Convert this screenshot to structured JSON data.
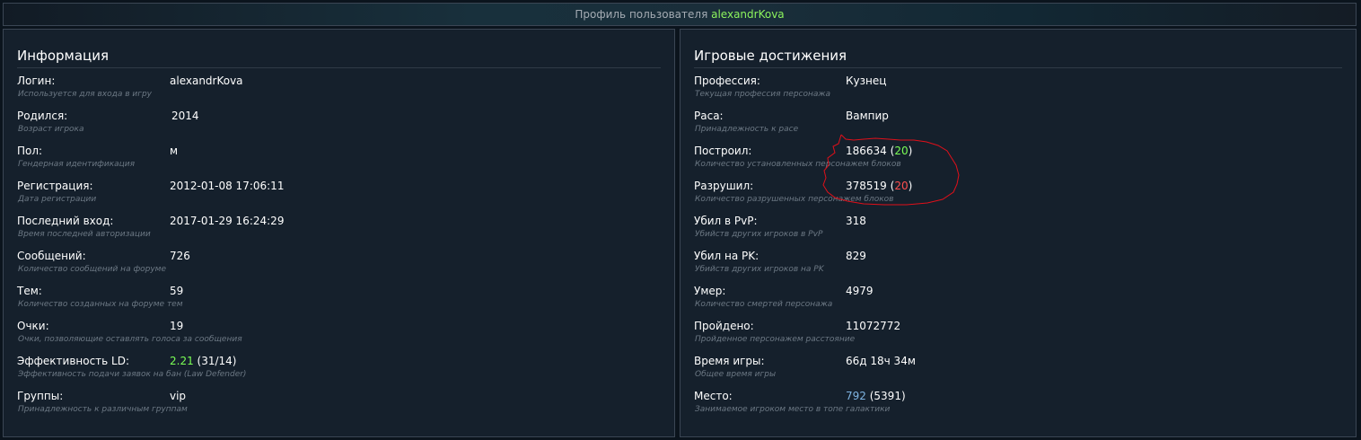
{
  "header": {
    "prefix": "Профиль пользователя",
    "username": "alexandrKova"
  },
  "info": {
    "title": "Информация",
    "rows": [
      {
        "label": "Логин:",
        "value": "alexandrKova",
        "desc": "Используется для входа в игру"
      },
      {
        "label": "Родился:",
        "value": "2014",
        "desc": "Возраст игрока"
      },
      {
        "label": "Пол:",
        "value": "м",
        "desc": "Гендерная идентификация"
      },
      {
        "label": "Регистрация:",
        "value": "2012-01-08 17:06:11",
        "desc": "Дата регистрации"
      },
      {
        "label": "Последний вход:",
        "value": "2017-01-29 16:24:29",
        "desc": "Время последней авторизации"
      },
      {
        "label": "Сообщений:",
        "value": "726",
        "desc": "Количество сообщений на форуме"
      },
      {
        "label": "Тем:",
        "value": "59",
        "desc": "Количество созданных на форуме тем"
      },
      {
        "label": "Очки:",
        "value": "19",
        "desc": "Очки, позволяющие оставлять голоса за сообщения"
      },
      {
        "label": "Эффективность LD:",
        "value": "2.21",
        "value_extra": "(31/14)",
        "desc": "Эффективность подачи заявок на бан (Law Defender)"
      },
      {
        "label": "Группы:",
        "value": "vip",
        "desc": "Принадлежность к различным группам"
      }
    ]
  },
  "achievements": {
    "title": "Игровые достижения",
    "rows": [
      {
        "label": "Профессия:",
        "value": "Кузнец",
        "desc": "Текущая профессия персонажа"
      },
      {
        "label": "Раса:",
        "value": "Вампир",
        "desc": "Принадлежность к расе"
      },
      {
        "label": "Построил:",
        "value": "186634",
        "value_extra": "20",
        "desc": "Количество установленных персонажем блоков"
      },
      {
        "label": "Разрушил:",
        "value": "378519",
        "value_extra": "20",
        "desc": "Количество разрушенных персонажем блоков"
      },
      {
        "label": "Убил в PvP:",
        "value": "318",
        "desc": "Убийств других игроков в PvP"
      },
      {
        "label": "Убил на PK:",
        "value": "829",
        "desc": "Убийств других игроков на PK"
      },
      {
        "label": "Умер:",
        "value": "4979",
        "desc": "Количество смертей персонажа"
      },
      {
        "label": "Пройдено:",
        "value": "11072772",
        "desc": "Пройденное персонажем расстояние"
      },
      {
        "label": "Время игры:",
        "value": "66д 18ч 34м",
        "desc": "Общее время игры"
      },
      {
        "label": "Место:",
        "value": "792",
        "value_extra": "(5391)",
        "desc": "Занимаемое игроком место в топе галактики"
      }
    ]
  },
  "colors": {
    "background": "#0b141d",
    "panel": "#15202c",
    "border": "#3b4654",
    "link_blue": "#7fb4e2",
    "accent_green": "#7bff55",
    "accent_red": "#ff4f4f",
    "annotation": "#e0101a"
  }
}
